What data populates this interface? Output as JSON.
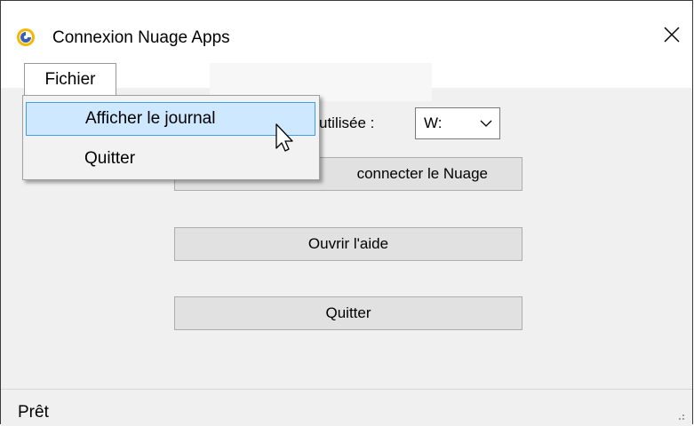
{
  "window": {
    "title": "Connexion Nuage Apps",
    "icon": "app-logo-icon",
    "close_icon": "close-icon"
  },
  "menu": {
    "fichier_label": "Fichier",
    "items": [
      {
        "label": "Afficher le journal",
        "state": "hover"
      },
      {
        "label": "Quitter",
        "state": "normal"
      }
    ]
  },
  "drive": {
    "label_visible": "utilisée :",
    "selected": "W:"
  },
  "buttons": {
    "connect_visible": "connecter le Nuage",
    "help": "Ouvrir l'aide",
    "quit": "Quitter"
  },
  "status": {
    "text": "Prêt"
  },
  "colors": {
    "logo_yellow": "#f5b800",
    "logo_blue": "#3a5fb8",
    "menu_highlight": "#cde8ff",
    "menu_highlight_border": "#3d9fe6"
  }
}
